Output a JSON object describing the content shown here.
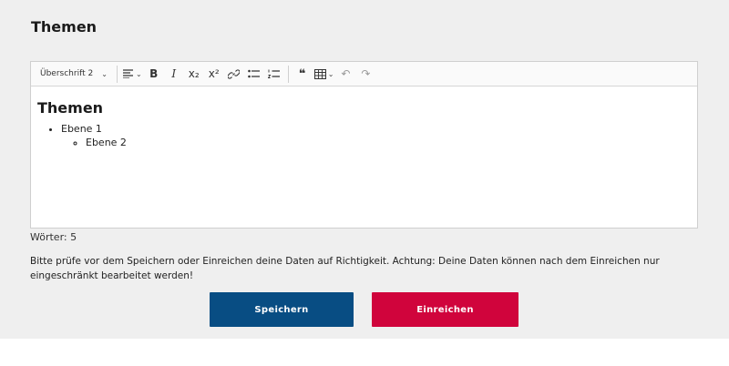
{
  "section_title": "Themen",
  "toolbar": {
    "heading_select_value": "Überschrift 2",
    "buttons": [
      {
        "name": "align-icon"
      },
      {
        "name": "bold-icon",
        "glyph": "B"
      },
      {
        "name": "italic-icon",
        "glyph": "I"
      },
      {
        "name": "subscript-icon"
      },
      {
        "name": "superscript-icon"
      },
      {
        "name": "link-icon"
      },
      {
        "name": "bulleted-list-icon"
      },
      {
        "name": "numbered-list-icon"
      },
      {
        "name": "blockquote-icon",
        "glyph": "❝"
      },
      {
        "name": "table-icon"
      },
      {
        "name": "undo-icon",
        "glyph": "↶"
      },
      {
        "name": "redo-icon",
        "glyph": "↷"
      }
    ],
    "sub_glyph": "x₂",
    "sup_glyph": "x²"
  },
  "editor": {
    "heading": "Themen",
    "list": {
      "level1": "Ebene 1",
      "level2": "Ebene 2"
    }
  },
  "word_count": "Wörter: 5",
  "notice": "Bitte prüfe vor dem Speichern oder Einreichen deine Daten auf Richtigkeit. Achtung: Deine Daten können nach dem Einreichen nur eingeschränkt bearbeitet werden!",
  "buttons": {
    "save": "Speichern",
    "submit": "Einreichen"
  },
  "colors": {
    "save": "#084d83",
    "submit": "#d0043c",
    "panel": "#efefef"
  }
}
